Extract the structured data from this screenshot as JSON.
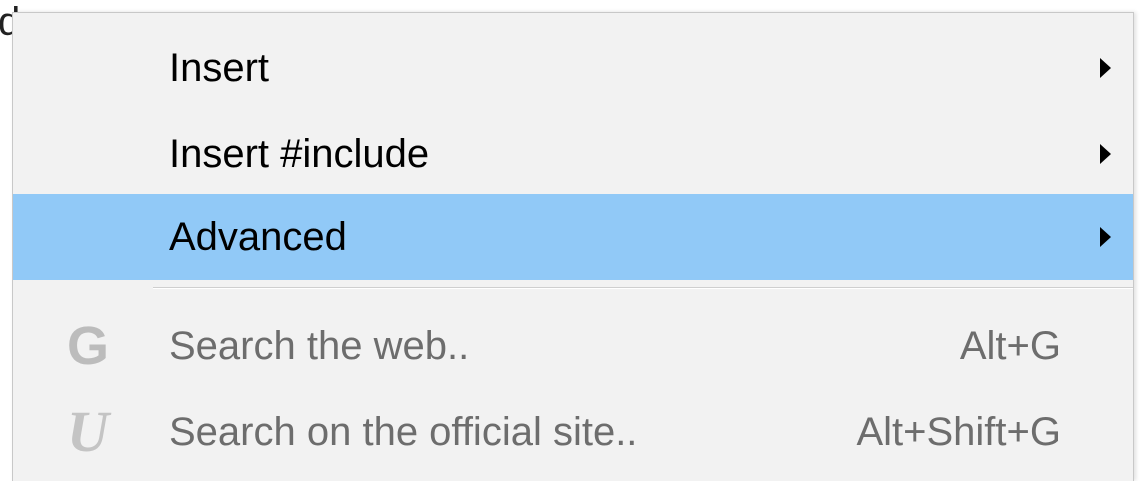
{
  "background": {
    "partial_text": "d"
  },
  "menu": {
    "items": [
      {
        "label": "Insert",
        "shortcut": "",
        "submenu": true,
        "disabled": false,
        "highlighted": false,
        "icon": ""
      },
      {
        "label": "Insert #include",
        "shortcut": "",
        "submenu": true,
        "disabled": false,
        "highlighted": false,
        "icon": ""
      },
      {
        "label": "Advanced",
        "shortcut": "",
        "submenu": true,
        "disabled": false,
        "highlighted": true,
        "icon": ""
      },
      {
        "label": "Search the web..",
        "shortcut": "Alt+G",
        "submenu": false,
        "disabled": true,
        "highlighted": false,
        "icon": "google-g-icon",
        "icon_glyph": "G"
      },
      {
        "label": "Search on the official site..",
        "shortcut": "Alt+Shift+G",
        "submenu": false,
        "disabled": true,
        "highlighted": false,
        "icon": "unreal-u-icon",
        "icon_glyph": "U"
      }
    ]
  },
  "colors": {
    "menu_bg": "#f2f2f2",
    "highlight": "#91c9f7",
    "disabled_text": "#6d6d6d",
    "icon_gray": "#bcbcbc"
  }
}
